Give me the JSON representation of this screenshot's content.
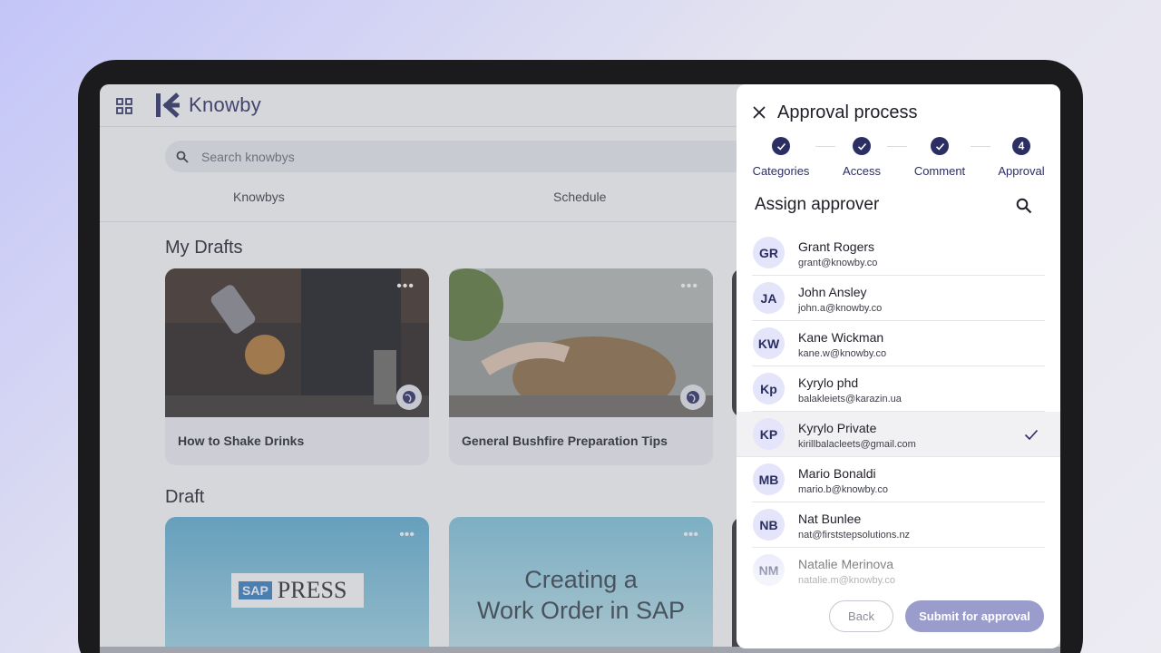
{
  "app": {
    "name": "Knowby",
    "search_placeholder": "Search knowbys",
    "tabs": [
      {
        "label": "Knowbys"
      },
      {
        "label": "Schedule"
      }
    ]
  },
  "sections": {
    "my_drafts": {
      "title": "My Drafts",
      "cards": [
        {
          "title": "How to Shake Drinks"
        },
        {
          "title": "General Bushfire Preparation Tips"
        }
      ]
    },
    "draft": {
      "title": "Draft",
      "cards": [
        {
          "logo_text": "PRESS",
          "logo_prefix": "SAP"
        },
        {
          "line1": "Creating a",
          "line2": "Work Order in SAP"
        }
      ]
    }
  },
  "panel": {
    "title": "Approval process",
    "steps": [
      {
        "label": "Categories",
        "state": "done"
      },
      {
        "label": "Access",
        "state": "done"
      },
      {
        "label": "Comment",
        "state": "done"
      },
      {
        "label": "Approval",
        "state": "current",
        "number": "4"
      }
    ],
    "assign_title": "Assign approver",
    "users": [
      {
        "initials": "GR",
        "name": "Grant Rogers",
        "email": "grant@knowby.co"
      },
      {
        "initials": "JA",
        "name": "John Ansley",
        "email": "john.a@knowby.co"
      },
      {
        "initials": "KW",
        "name": "Kane Wickman",
        "email": "kane.w@knowby.co"
      },
      {
        "initials": "Kp",
        "name": "Kyrylo phd",
        "email": "balakleiets@karazin.ua"
      },
      {
        "initials": "KP",
        "name": "Kyrylo Private",
        "email": "kirillbalacleets@gmail.com"
      },
      {
        "initials": "MB",
        "name": "Mario Bonaldi",
        "email": "mario.b@knowby.co"
      },
      {
        "initials": "NB",
        "name": "Nat Bunlee",
        "email": "nat@firststepsolutions.nz"
      },
      {
        "initials": "NM",
        "name": "Natalie Merinova",
        "email": "natalie.m@knowby.co"
      }
    ],
    "selected_user": "Kyrylo Private",
    "back_label": "Back",
    "submit_label": "Submit for approval"
  },
  "colors": {
    "brand": "#2b2e62",
    "avatar_bg": "#e4e4fa",
    "submit_disabled": "#9a9ccc"
  }
}
